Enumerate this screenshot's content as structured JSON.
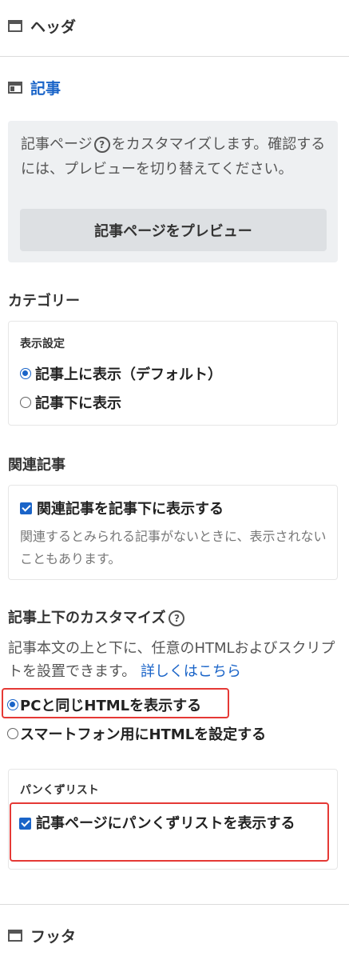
{
  "header_section": {
    "label": "ヘッダ"
  },
  "article_section": {
    "label": "記事"
  },
  "article_info": {
    "text_before": "記事ページ",
    "text_after": "をカスタマイズします。確認するには、プレビューを切り替えてください。",
    "preview_button": "記事ページをプレビュー"
  },
  "category": {
    "title": "カテゴリー",
    "display_label": "表示設定",
    "options": [
      {
        "label": "記事上に表示（デフォルト）",
        "selected": true
      },
      {
        "label": "記事下に表示",
        "selected": false
      }
    ]
  },
  "related": {
    "title": "関連記事",
    "checkbox_label": "関連記事を記事下に表示する",
    "checked": true,
    "note": "関連するとみられる記事がないときに、表示されないこともあります。"
  },
  "customize": {
    "title": "記事上下のカスタマイズ",
    "description": "記事本文の上と下に、任意のHTMLおよびスクリプトを設置できます。",
    "link": "詳しくはこちら",
    "options": [
      {
        "label": "PCと同じHTMLを表示する",
        "selected": true
      },
      {
        "label": "スマートフォン用にHTMLを設定する",
        "selected": false
      }
    ]
  },
  "breadcrumb": {
    "title": "パンくずリスト",
    "checkbox_label": "記事ページにパンくずリストを表示する",
    "checked": true
  },
  "footer_section": {
    "label": "フッタ"
  },
  "colors": {
    "accent": "#1a64c8",
    "highlight": "#e53935"
  }
}
